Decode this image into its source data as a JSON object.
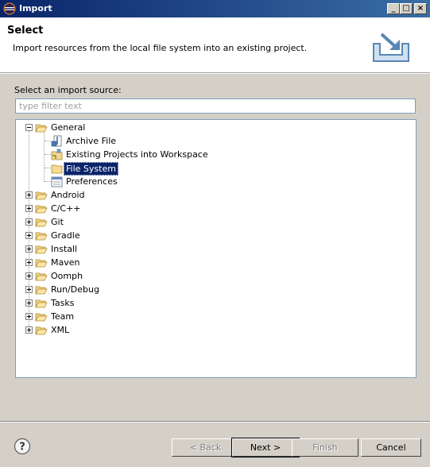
{
  "window": {
    "title": "Import",
    "minimize": "_",
    "maximize": "□",
    "close": "×"
  },
  "header": {
    "title": "Select",
    "description": "Import resources from the local file system into an existing project."
  },
  "source": {
    "label": "Select an import source:",
    "filter_placeholder": "type filter text",
    "filter_value": ""
  },
  "tree": {
    "general": {
      "label": "General",
      "expanded": true,
      "children": [
        {
          "label": "Archive File",
          "icon": "archive-file-icon"
        },
        {
          "label": "Existing Projects into Workspace",
          "icon": "projects-folder-icon"
        },
        {
          "label": "File System",
          "icon": "folder-icon",
          "selected": true
        },
        {
          "label": "Preferences",
          "icon": "preferences-icon"
        }
      ]
    },
    "categories": [
      {
        "label": "Android"
      },
      {
        "label": "C/C++"
      },
      {
        "label": "Git"
      },
      {
        "label": "Gradle"
      },
      {
        "label": "Install"
      },
      {
        "label": "Maven"
      },
      {
        "label": "Oomph"
      },
      {
        "label": "Run/Debug"
      },
      {
        "label": "Tasks"
      },
      {
        "label": "Team"
      },
      {
        "label": "XML"
      }
    ]
  },
  "buttons": {
    "help": "?",
    "back": "< Back",
    "next": "Next >",
    "finish": "Finish",
    "cancel": "Cancel"
  },
  "colors": {
    "selection": "#0a246a",
    "folder": "#e8c66a",
    "titlebar": "#0a246a"
  }
}
